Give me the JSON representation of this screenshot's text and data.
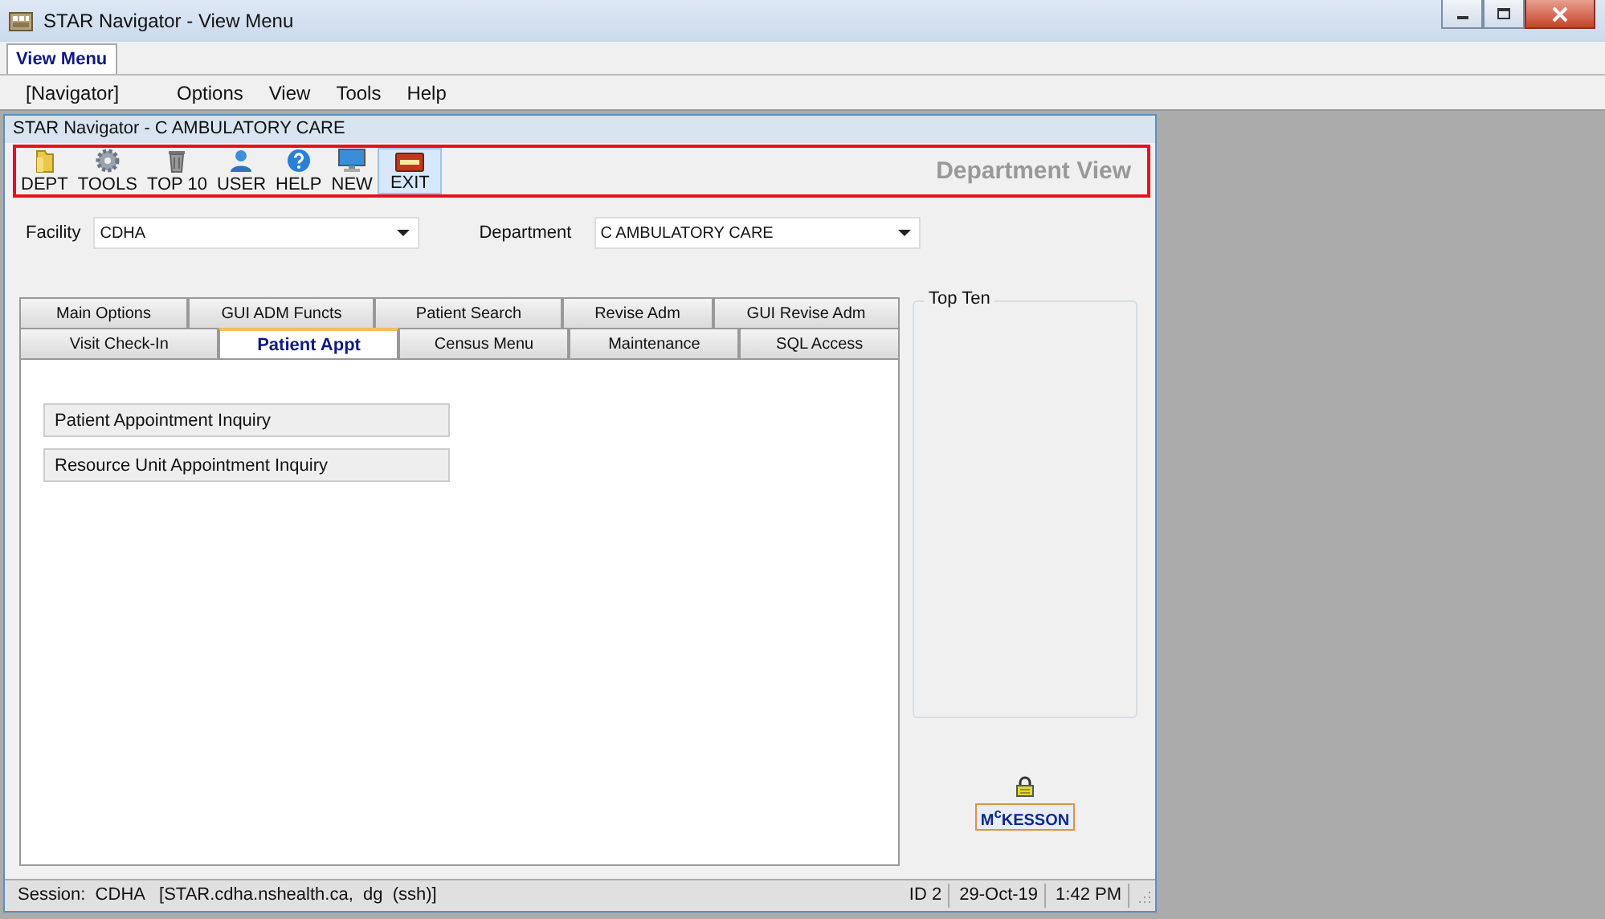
{
  "window": {
    "title": "STAR Navigator - View Menu"
  },
  "tab_strip": [
    {
      "label": "View Menu",
      "selected": true
    }
  ],
  "menu": [
    "[Navigator]",
    "Options",
    "View",
    "Tools",
    "Help"
  ],
  "child_window": {
    "title": "STAR Navigator - C AMBULATORY CARE"
  },
  "toolbar": {
    "buttons": [
      {
        "label": "DEPT",
        "kind": "folder",
        "highlighted": false
      },
      {
        "label": "TOOLS",
        "kind": "gear",
        "highlighted": false
      },
      {
        "label": "TOP 10",
        "kind": "trash",
        "highlighted": false
      },
      {
        "label": "USER",
        "kind": "user",
        "highlighted": false
      },
      {
        "label": "HELP",
        "kind": "help",
        "highlighted": false
      },
      {
        "label": "NEW",
        "kind": "monitor",
        "highlighted": false
      },
      {
        "label": "EXIT",
        "kind": "exit",
        "highlighted": true
      }
    ],
    "view_title": "Department View"
  },
  "fields": [
    {
      "label": "Facility",
      "value": "CDHA"
    },
    {
      "label": "Department",
      "value": "C AMBULATORY CARE"
    }
  ],
  "tab_rows": [
    [
      {
        "label": "Main Options",
        "selected": false
      },
      {
        "label": "GUI ADM Functs",
        "selected": false
      },
      {
        "label": "Patient Search",
        "selected": false
      },
      {
        "label": "Revise Adm",
        "selected": false
      },
      {
        "label": "GUI Revise Adm",
        "selected": false
      }
    ],
    [
      {
        "label": "Visit Check-In",
        "selected": false
      },
      {
        "label": "Patient Appt",
        "selected": true
      },
      {
        "label": "Census Menu",
        "selected": false
      },
      {
        "label": "Maintenance",
        "selected": false
      },
      {
        "label": "SQL Access",
        "selected": false
      }
    ]
  ],
  "actions": [
    "Patient Appointment Inquiry",
    "Resource Unit Appointment Inquiry"
  ],
  "top_ten": {
    "title": "Top Ten"
  },
  "logo": "M$^{c}$KESSON",
  "status_bar": {
    "session": "Session:  CDHA   [STAR.cdha.nshealth.ca,  dg  (ssh)]",
    "id": "ID 2",
    "date": "29-Oct-19",
    "time": "1:42 PM"
  }
}
